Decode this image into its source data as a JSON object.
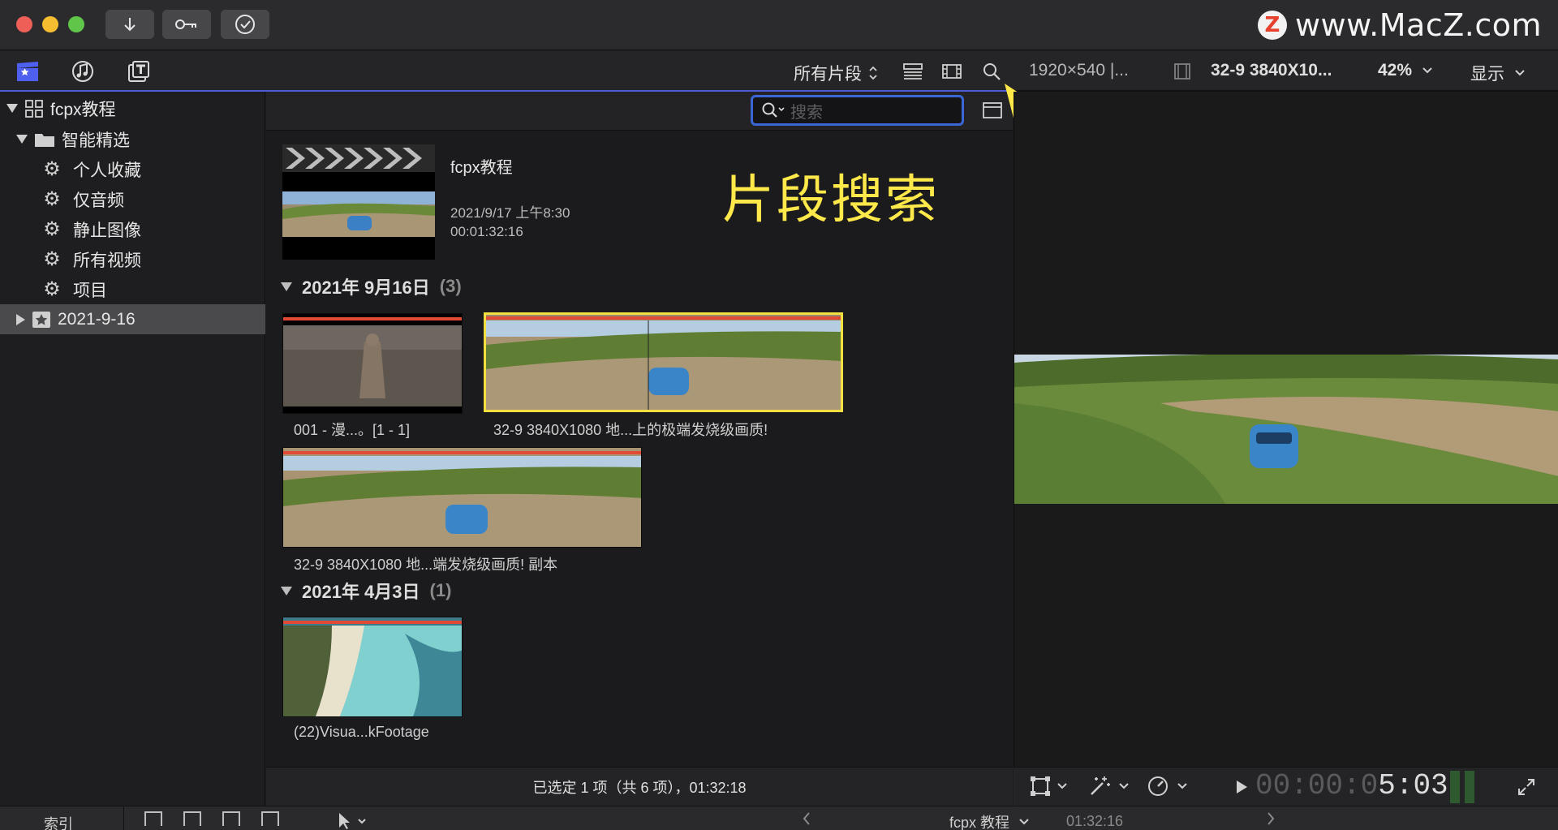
{
  "watermark": {
    "logo_letter": "Z",
    "text": "www.MacZ.com"
  },
  "toolbar2": {
    "filter_label": "所有片段",
    "viewer_format": "1920×540 |...",
    "clip_name": "32-9 3840X10...",
    "zoom": "42%",
    "display_label": "显示"
  },
  "search": {
    "placeholder": "搜索"
  },
  "sidebar": {
    "items": [
      {
        "label": "fcpx教程"
      },
      {
        "label": "智能精选"
      },
      {
        "label": "个人收藏"
      },
      {
        "label": "仅音频"
      },
      {
        "label": "静止图像"
      },
      {
        "label": "所有视频"
      },
      {
        "label": "项目"
      },
      {
        "label": "2021-9-16"
      }
    ]
  },
  "project": {
    "title": "fcpx教程",
    "date": "2021/9/17 上午8:30",
    "duration": "00:01:32:16"
  },
  "annotation": {
    "text": "片段搜索"
  },
  "sections": [
    {
      "title": "2021年 9月16日",
      "count": "(3)",
      "clips": [
        {
          "caption": "001 - 漫...。[1 - 1]"
        },
        {
          "caption": "32-9 3840X1080 地...上的极端发烧级画质!"
        },
        {
          "caption": "32-9 3840X1080 地...端发烧级画质!  副本"
        }
      ]
    },
    {
      "title": "2021年 4月3日",
      "count": "(1)",
      "clips": [
        {
          "caption": "(22)Visua...kFootage"
        }
      ]
    }
  ],
  "status": {
    "text": "已选定 1 项（共 6 项），01:32:18"
  },
  "viewer": {
    "timecode_dim": "00:00:0",
    "timecode_bright": "5:03"
  },
  "bottombar": {
    "index_label": "索引",
    "project_label": "fcpx 教程",
    "timecode": "01:32:16"
  },
  "colors": {
    "accent_blue": "#3a66d6",
    "clip_bar_red": "#e14a34",
    "selection_yellow": "#f3df3f",
    "annotation_yellow": "#ffe94a"
  }
}
